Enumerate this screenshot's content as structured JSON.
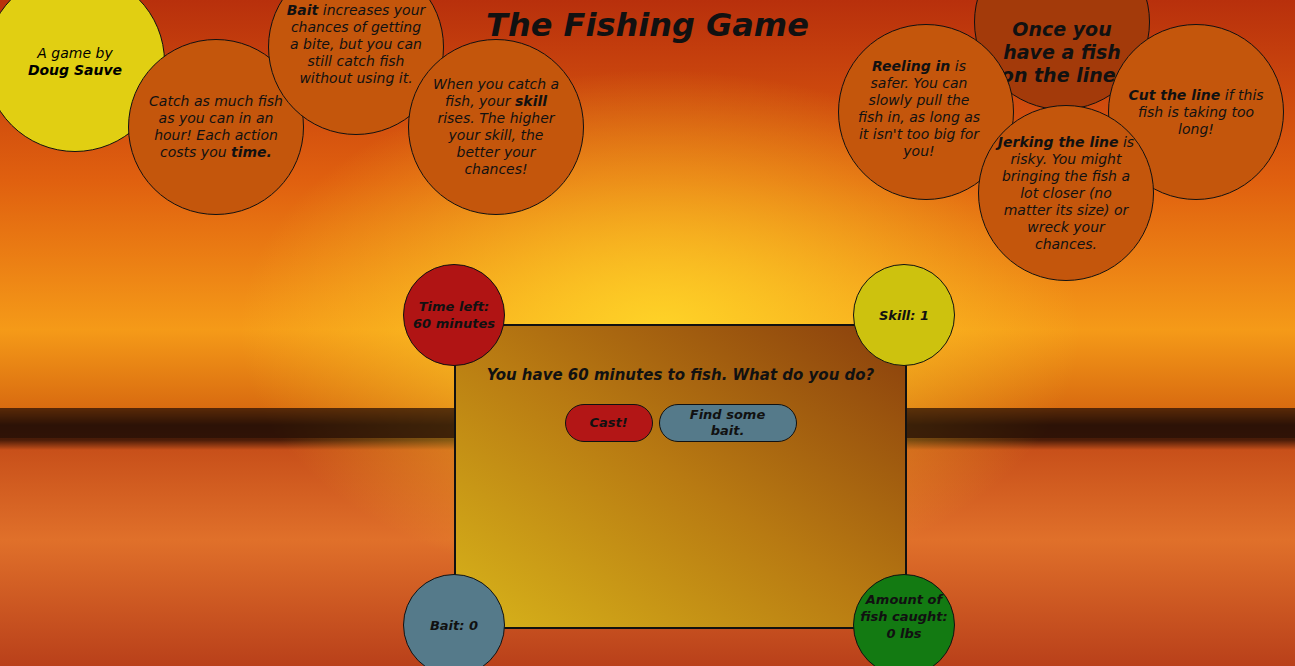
{
  "title": "The Fishing Game",
  "credit": {
    "text": "A game by",
    "author": "Doug Sauve"
  },
  "tips": [
    {
      "kind": "tip",
      "segments": [
        {
          "text": "Catch as much fish as you can in an hour! Each action costs you ",
          "bold": false
        },
        {
          "text": "time.",
          "bold": true
        }
      ]
    },
    {
      "kind": "tip",
      "segments": [
        {
          "text": "Bait",
          "bold": true
        },
        {
          "text": " increases your chances of getting a bite, but you can still catch fish without using it.",
          "bold": false
        }
      ]
    },
    {
      "kind": "tip",
      "segments": [
        {
          "text": "When you catch a fish, your ",
          "bold": false
        },
        {
          "text": "skill",
          "bold": true
        },
        {
          "text": " rises. The higher your skill, the better your chances!",
          "bold": false
        }
      ]
    },
    {
      "kind": "heading",
      "segments": [
        {
          "text": "Once you have a fish on the line:",
          "bold": true
        }
      ]
    },
    {
      "kind": "tip",
      "segments": [
        {
          "text": "Reeling in",
          "bold": true
        },
        {
          "text": " is safer. You can slowly pull the fish in, as long as it isn't too big for you!",
          "bold": false
        }
      ]
    },
    {
      "kind": "tip",
      "segments": [
        {
          "text": "Cut the line",
          "bold": true
        },
        {
          "text": " if this fish is taking too long!",
          "bold": false
        }
      ]
    },
    {
      "kind": "tip",
      "segments": [
        {
          "text": "Jerking the line",
          "bold": true
        },
        {
          "text": " is risky. You might bringing the fish a lot closer (no matter its size) or wreck your chances.",
          "bold": false
        }
      ]
    }
  ],
  "stats": {
    "time": "Time left: 60 minutes",
    "skill": "Skill: 1",
    "bait": "Bait: 0",
    "fish": "Amount of fish caught: 0 lbs"
  },
  "panel": {
    "message": "You have 60 minutes to fish. What do you do?"
  },
  "buttons": [
    "Cast!",
    "Find some bait."
  ]
}
